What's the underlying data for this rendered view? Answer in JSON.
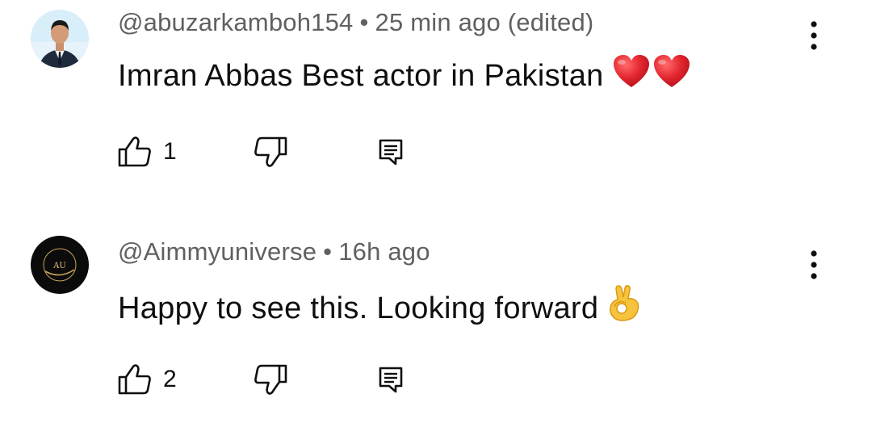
{
  "comments": [
    {
      "handle": "@abuzarkamboh154",
      "separator": "•",
      "time": "25 min ago (edited)",
      "text": "Imran Abbas Best actor in Pakistan",
      "emoji": [
        "red-heart",
        "red-heart"
      ],
      "like_count": "1",
      "avatar_icon": "person-photo"
    },
    {
      "handle": "@Aimmyuniverse",
      "separator": "•",
      "time": "16h ago",
      "text": "Happy to see this. Looking forward",
      "emoji": [
        "ok-hand"
      ],
      "like_count": "2",
      "avatar_icon": "au-logo",
      "avatar_logo_text": "AU"
    }
  ],
  "icons": {
    "like": "thumbs-up-icon",
    "dislike": "thumbs-down-icon",
    "reply": "reply-icon",
    "more": "more-vertical-icon"
  },
  "colors": {
    "meta_text": "#606060",
    "body_text": "#0f0f0f",
    "heart": "#e0202e",
    "ok_hand": "#f7c23c"
  }
}
